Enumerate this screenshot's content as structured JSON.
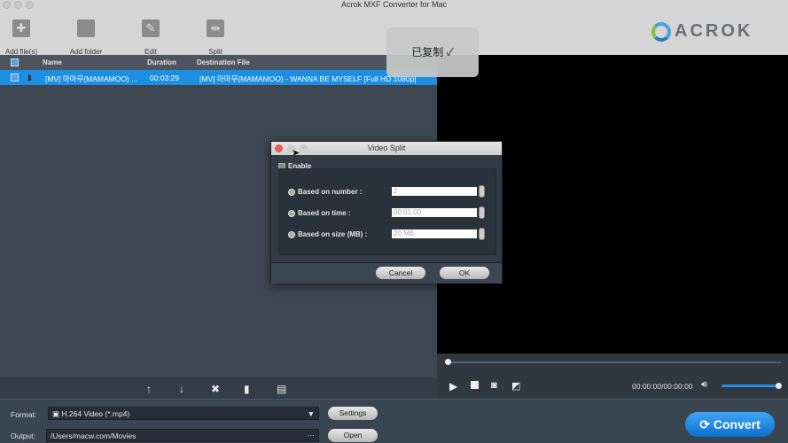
{
  "window": {
    "title": "Acrok MXF Converter for Mac"
  },
  "toolbar": {
    "add_files": "Add file(s)",
    "add_folder": "Add folder",
    "edit": "Edit",
    "split": "Split"
  },
  "logo": "ACROK",
  "toast": {
    "text": "已复制",
    "icon": "checkmark-icon"
  },
  "table": {
    "headers": {
      "name": "Name",
      "duration": "Duration",
      "destination": "Destination File"
    },
    "rows": [
      {
        "name": "[MV] 마마무(MAMAMOO) ...",
        "duration": "00:03:29",
        "destination": "[MV] 마마무(MAMAMOO) - WANNA BE MYSELF [Full HD 1080p]",
        "checked": true,
        "selected": true
      }
    ]
  },
  "dialog": {
    "title": "Video Split",
    "enable": "Enable",
    "options": [
      {
        "label": "Based on number :",
        "value": "2"
      },
      {
        "label": "Based on time :",
        "value": "00:01:00"
      },
      {
        "label": "Based on size (MB) :",
        "value": "20 MB"
      }
    ],
    "cancel": "Cancel",
    "ok": "OK"
  },
  "player": {
    "time": "00:00:00/00:00:00",
    "volume": 1.0,
    "progress": 0
  },
  "bottom": {
    "format_label": "Format:",
    "format_value": "H.264 Video (*.mp4)",
    "settings": "Settings",
    "output_label": "Output:",
    "output_value": "/Users/macw.com/Movies",
    "open": "Open",
    "convert": "Convert"
  },
  "colors": {
    "accent": "#1d8fe3",
    "convert": "#1a84e0"
  }
}
